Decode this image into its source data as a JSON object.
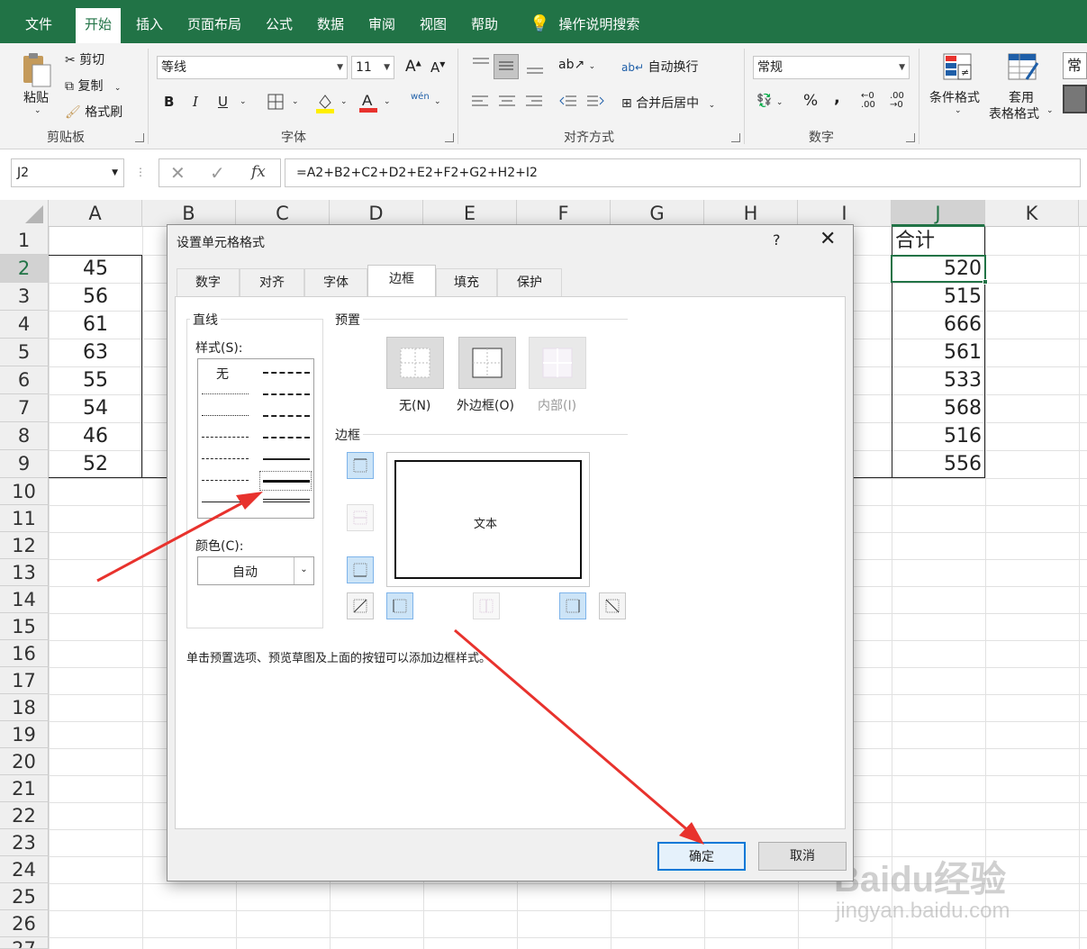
{
  "ribbon": {
    "tabs": [
      "文件",
      "开始",
      "插入",
      "页面布局",
      "公式",
      "数据",
      "审阅",
      "视图",
      "帮助",
      "操作说明搜索"
    ],
    "active_tab": "开始",
    "clipboard": {
      "paste": "粘贴",
      "cut": "剪切",
      "copy": "复制",
      "format_painter": "格式刷",
      "label": "剪贴板"
    },
    "font": {
      "name": "等线",
      "size": "11",
      "label": "字体",
      "bold": "B",
      "italic": "I",
      "underline": "U",
      "grow": "A",
      "shrink": "A",
      "phonetic": "wén"
    },
    "alignment": {
      "wrap": "自动换行",
      "merge": "合并后居中",
      "label": "对齐方式"
    },
    "number": {
      "format": "常规",
      "percent": "%",
      "comma": ",",
      "label": "数字"
    },
    "styles": {
      "conditional": "条件格式",
      "table_line1": "套用",
      "table_line2": "表格格式",
      "cell_style": "常"
    }
  },
  "formula_bar": {
    "name_box": "J2",
    "formula": "=A2+B2+C2+D2+E2+F2+G2+H2+I2",
    "fx": "fx"
  },
  "columns": [
    "A",
    "B",
    "C",
    "D",
    "E",
    "F",
    "G",
    "H",
    "I",
    "J",
    "K"
  ],
  "selected_column": "J",
  "rows": [
    "1",
    "2",
    "3",
    "4",
    "5",
    "6",
    "7",
    "8",
    "9",
    "10",
    "11",
    "12",
    "13",
    "14",
    "15",
    "16",
    "17",
    "18",
    "19",
    "20",
    "21",
    "22",
    "23",
    "24",
    "25",
    "26",
    "27"
  ],
  "col_a_values": [
    "45",
    "56",
    "61",
    "63",
    "55",
    "54",
    "46",
    "52"
  ],
  "col_j_header": "合计",
  "col_j_values": [
    "520",
    "515",
    "666",
    "561",
    "533",
    "568",
    "516",
    "556"
  ],
  "dialog": {
    "title": "设置单元格格式",
    "help": "?",
    "close": "✕",
    "tabs": [
      "数字",
      "对齐",
      "字体",
      "边框",
      "填充",
      "保护"
    ],
    "active_tab": "边框",
    "line_group": "直线",
    "style_label": "样式(S):",
    "style_none": "无",
    "color_label": "颜色(C):",
    "color_value": "自动",
    "presets_group": "预置",
    "presets": [
      "无(N)",
      "外边框(O)",
      "内部(I)"
    ],
    "border_group": "边框",
    "preview_text": "文本",
    "hint": "单击预置选项、预览草图及上面的按钮可以添加边框样式。",
    "ok": "确定",
    "cancel": "取消"
  },
  "watermark": {
    "brand": "Baidu经验",
    "url": "jingyan.baidu.com"
  },
  "colors": {
    "excel_green": "#217346",
    "annotation_red": "#e8322d",
    "accent_blue": "#0078d7"
  }
}
